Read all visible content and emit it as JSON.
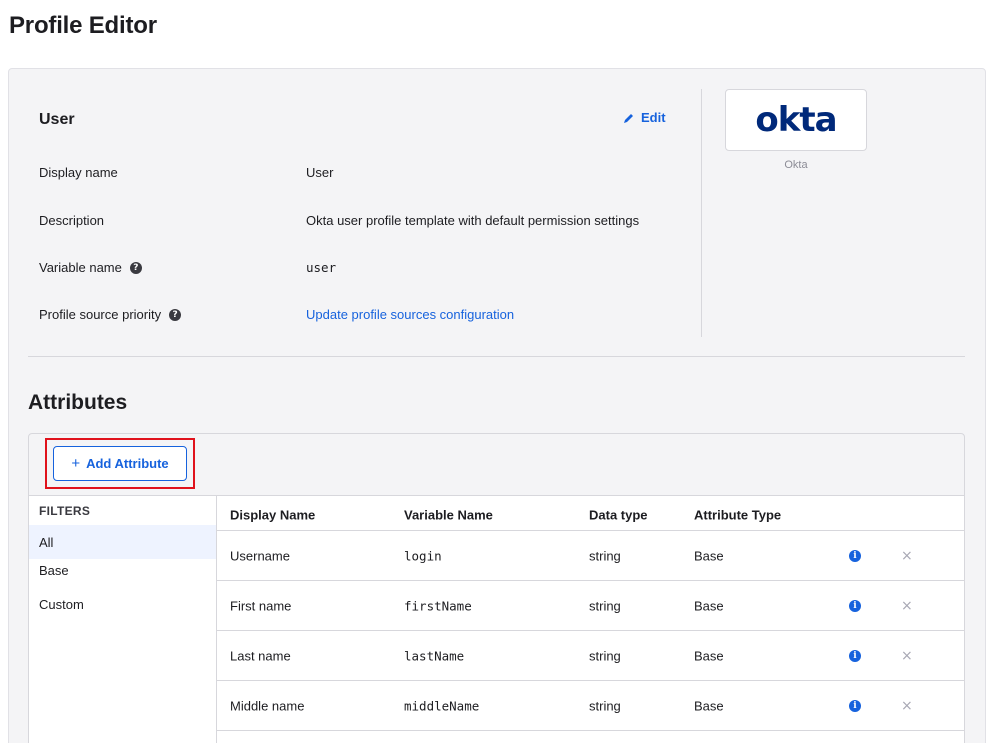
{
  "page": {
    "title": "Profile Editor"
  },
  "profile": {
    "title": "User",
    "edit_label": "Edit",
    "fields": [
      {
        "label": "Display name",
        "value": "User"
      },
      {
        "label": "Description",
        "value": "Okta user profile template with default permission settings"
      },
      {
        "label": "Variable name",
        "value": "user"
      },
      {
        "label": "Profile source priority",
        "value": "Update profile sources configuration"
      }
    ],
    "app_logo_text": "okta",
    "app_name": "Okta"
  },
  "attributes": {
    "title": "Attributes",
    "add_button_label": "Add Attribute",
    "filters": {
      "header": "FILTERS",
      "items": [
        "All",
        "Base",
        "Custom"
      ],
      "selected": "All"
    },
    "columns": [
      "Display Name",
      "Variable Name",
      "Data type",
      "Attribute Type"
    ],
    "rows": [
      {
        "display_name": "Username",
        "variable_name": "login",
        "data_type": "string",
        "attribute_type": "Base"
      },
      {
        "display_name": "First name",
        "variable_name": "firstName",
        "data_type": "string",
        "attribute_type": "Base"
      },
      {
        "display_name": "Last name",
        "variable_name": "lastName",
        "data_type": "string",
        "attribute_type": "Base"
      },
      {
        "display_name": "Middle name",
        "variable_name": "middleName",
        "data_type": "string",
        "attribute_type": "Base"
      }
    ]
  },
  "colors": {
    "link": "#1662dd",
    "highlight": "#e0121c",
    "logo": "#00297a"
  },
  "icons": {
    "edit": "pencil-icon",
    "help": "question-circle-icon",
    "info": "info-circle-icon",
    "remove": "close-icon",
    "add": "plus-icon"
  }
}
